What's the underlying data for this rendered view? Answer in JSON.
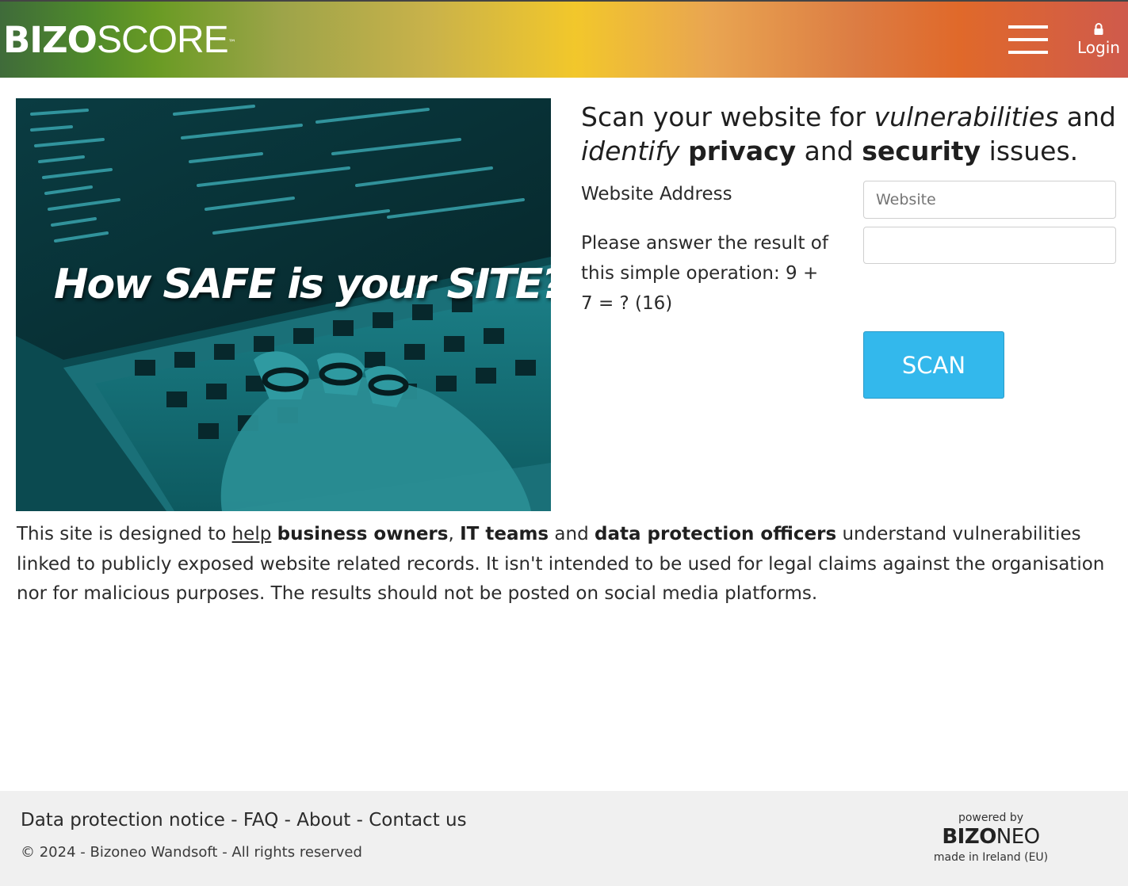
{
  "header": {
    "logo_bold": "BIZO",
    "logo_light": "SCORE",
    "logo_tm": "™",
    "login_label": "Login"
  },
  "hero": {
    "image_text": "How SAFE is your SITE?"
  },
  "form": {
    "headline_1": "Scan your website for ",
    "headline_2": "vulnerabilities",
    "headline_3": " and ",
    "headline_4": "identify",
    "headline_5": " ",
    "headline_6": "privacy",
    "headline_7": " and ",
    "headline_8": "security",
    "headline_9": " issues.",
    "website_label": "Website Address",
    "website_placeholder": "Website",
    "website_value": "",
    "captcha_label": "Please answer the result of this simple operation: 9 + 7 = ? (16)",
    "captcha_value": "",
    "scan_label": "SCAN"
  },
  "description": {
    "p1": "This site is designed to ",
    "help_link": "help",
    "p2": " ",
    "b1": "business owners",
    "p3": ", ",
    "b2": "IT teams",
    "p4": " and ",
    "b3": "data protection officers",
    "p5": " understand vulnerabilities linked to publicly exposed website related records. It isn't intended to be used for legal claims against the organisation nor for malicious purposes. The results should not be posted on social media platforms."
  },
  "footer": {
    "link_data_protection": "Data protection notice",
    "sep": " - ",
    "link_faq": "FAQ",
    "link_about": "About",
    "link_contact": "Contact us",
    "copyright": "© 2024 - Bizoneo Wandsoft - All rights reserved",
    "powered_by": "powered by",
    "powered_logo_bold": "BIZO",
    "powered_logo_light": "NEO",
    "made_in": "made in Ireland (EU)"
  },
  "colors": {
    "scan_button": "#33b8ec",
    "footer_bg": "#f0f0f0",
    "hero_tint": "#0f5d63"
  }
}
